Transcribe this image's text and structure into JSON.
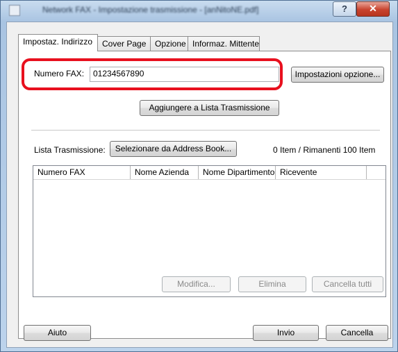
{
  "window": {
    "title": "Network FAX - Impostazione trasmissione - [anNitoNE.pdf]",
    "help_glyph": "?",
    "close_glyph": "✕"
  },
  "tabs": [
    {
      "label": "Impostaz. Indirizzo",
      "active": true
    },
    {
      "label": "Cover Page",
      "active": false
    },
    {
      "label": "Opzione",
      "active": false
    },
    {
      "label": "Informaz. Mittente",
      "active": false
    }
  ],
  "fax": {
    "label": "Numero FAX:",
    "value": "01234567890",
    "options_button": "Impostazioni opzione..."
  },
  "add_button": "Aggiungere a Lista Trasmissione",
  "list": {
    "label": "Lista Trasmissione:",
    "select_button": "Selezionare da Address Book...",
    "count_text": "0 Item / Rimanenti 100 Item",
    "columns": [
      "Numero FAX",
      "Nome Azienda",
      "Nome Dipartimento",
      "Ricevente"
    ],
    "rows": []
  },
  "list_actions": {
    "edit": "Modifica...",
    "delete": "Elimina",
    "clear_all": "Cancella tutti"
  },
  "footer": {
    "help": "Aiuto",
    "send": "Invio",
    "cancel": "Cancella"
  },
  "colors": {
    "highlight": "#e8101e",
    "close_button": "#c8432e"
  }
}
